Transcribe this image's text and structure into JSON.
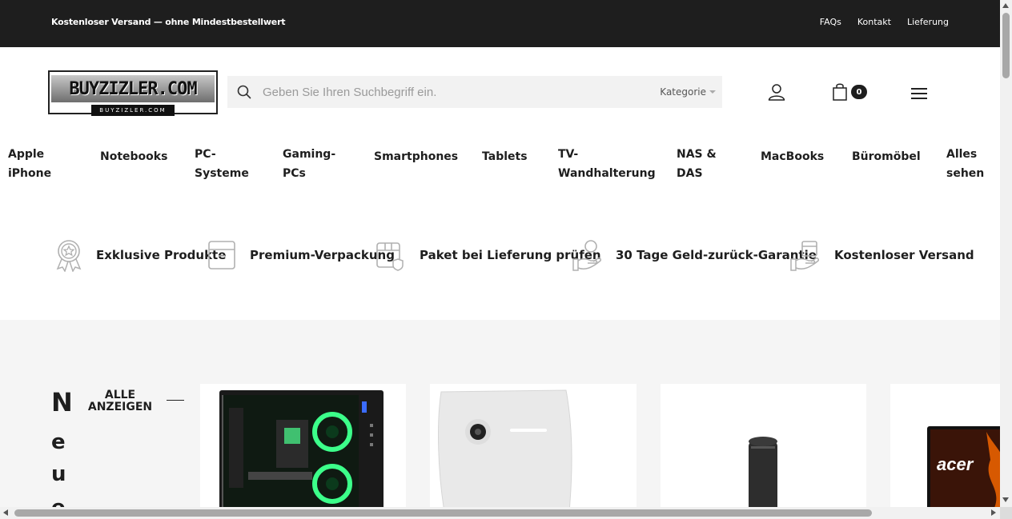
{
  "topbar": {
    "promo": "Kostenloser Versand — ohne Mindestbestellwert",
    "links": [
      "FAQs",
      "Kontakt",
      "Lieferung"
    ]
  },
  "header": {
    "logo_text": "BUYZIZLER.COM",
    "logo_subtext": "BUYZIZLER.COM",
    "search_placeholder": "Geben Sie Ihren Suchbegriff ein.",
    "category_label": "Kategorie",
    "cart_count": "0"
  },
  "nav": {
    "items": [
      {
        "line1": "Apple",
        "line2": "iPhone"
      },
      {
        "line1": "Notebooks",
        "line2": ""
      },
      {
        "line1": "PC-",
        "line2": "Systeme"
      },
      {
        "line1": "Gaming-",
        "line2": "PCs"
      },
      {
        "line1": "Smartphones",
        "line2": ""
      },
      {
        "line1": "Tablets",
        "line2": ""
      },
      {
        "line1": "TV-",
        "line2": "Wandhalterung"
      },
      {
        "line1": "NAS &",
        "line2": "DAS"
      },
      {
        "line1": "MacBooks",
        "line2": ""
      },
      {
        "line1": "Büromöbel",
        "line2": ""
      },
      {
        "line1": "Alles",
        "line2": "sehen"
      }
    ]
  },
  "features": [
    {
      "icon": "award-icon",
      "label": "Exklusive Produkte"
    },
    {
      "icon": "box-icon",
      "label": "Premium-Verpackung"
    },
    {
      "icon": "package-check-icon",
      "label": "Paket bei Lieferung prüfen"
    },
    {
      "icon": "hand-money-icon",
      "label": "30 Tage Geld-zurück-Garantie"
    },
    {
      "icon": "hand-box-icon",
      "label": "Kostenloser Versand"
    }
  ],
  "new_section": {
    "vertical_title_letters": [
      "N",
      "e",
      "u",
      "e"
    ],
    "show_all_label": "ALLE ANZEIGEN",
    "card_brand_text": "acer"
  },
  "colors": {
    "topbar_bg": "#1e1e1e",
    "section_bg": "#f5f5f5",
    "search_bg": "#f2f2f2"
  }
}
